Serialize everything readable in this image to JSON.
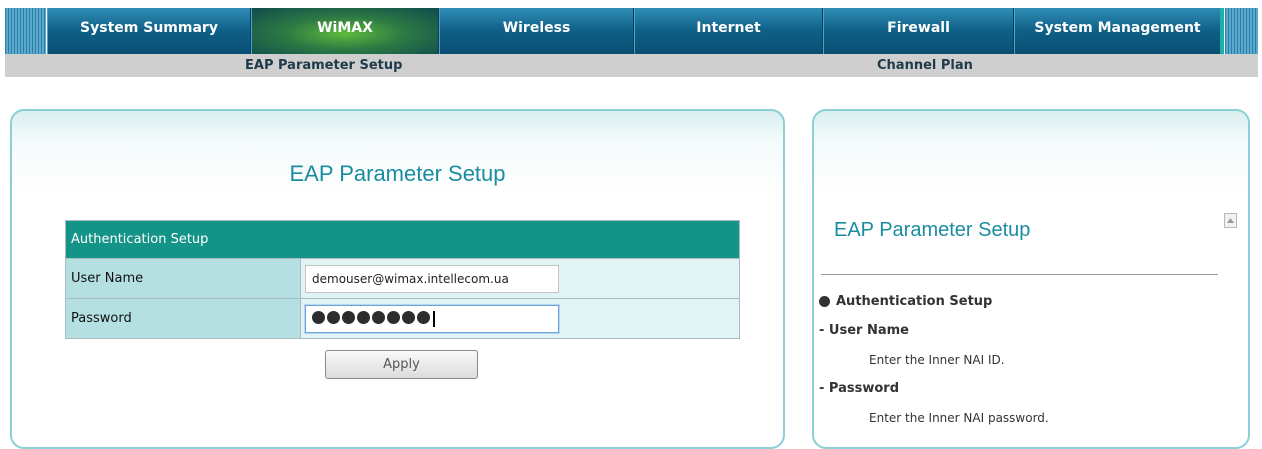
{
  "nav": {
    "tabs": [
      {
        "label": "System Summary"
      },
      {
        "label": "WiMAX"
      },
      {
        "label": "Wireless"
      },
      {
        "label": "Internet"
      },
      {
        "label": "Firewall"
      },
      {
        "label": "System Management"
      }
    ],
    "active_tab": "WiMAX",
    "subnav": [
      "EAP Parameter Setup",
      "Channel Plan"
    ]
  },
  "main": {
    "title": "EAP Parameter Setup",
    "section_header": "Authentication Setup",
    "fields": {
      "username": {
        "label": "User Name",
        "value": "demouser@wimax.intellecom.ua"
      },
      "password": {
        "label": "Password",
        "masked_length": 8
      }
    },
    "apply_label": "Apply"
  },
  "help": {
    "title": "EAP Parameter Setup",
    "section": "Authentication Setup",
    "items": [
      {
        "term": "- User Name",
        "description": "Enter the Inner NAI ID."
      },
      {
        "term": "- Password",
        "description": "Enter the Inner NAI password."
      }
    ]
  },
  "colors": {
    "nav_blue": "#0f5f86",
    "active_green": "#5fbb3c",
    "table_header": "#139487",
    "label_cell": "#b5e0e2",
    "title_teal": "#1a8ca0"
  }
}
